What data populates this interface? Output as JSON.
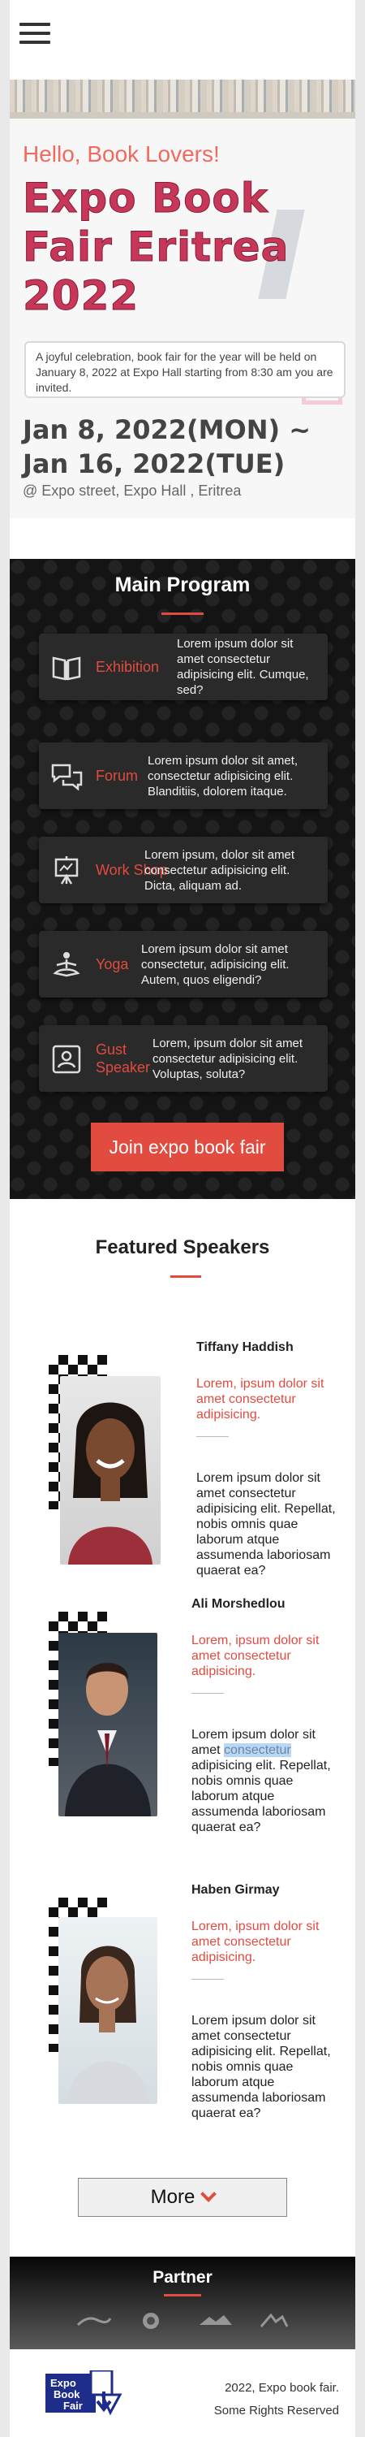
{
  "header": {
    "menu_icon": "hamburger-menu-icon"
  },
  "hero": {
    "greeting": "Hello, Book Lovers!",
    "title": "Expo Book Fair Eritrea 2022",
    "description": "A joyful celebration, book fair for the year will be held on January 8, 2022 at Expo Hall starting from 8:30 am you are invited.",
    "dates": "Jan 8, 2022(MON) ~ Jan 16, 2022(TUE)",
    "address": "@ Expo street, Expo Hall , Eritrea"
  },
  "program": {
    "title": "Main Program",
    "items": [
      {
        "icon": "open-book-icon",
        "name": "Exhibition",
        "text": "Lorem ipsum dolor sit amet consectetur adipisicing elit. Cumque, sed?"
      },
      {
        "icon": "chat-bubbles-icon",
        "name": "Forum",
        "text": "Lorem ipsum dolor sit amet, consectetur adipisicing elit. Blanditiis, dolorem itaque."
      },
      {
        "icon": "easel-board-icon",
        "name": "Work Shop",
        "text": "Lorem ipsum, dolor sit amet consectetur adipisicing elit. Dicta, aliquam ad."
      },
      {
        "icon": "meditation-icon",
        "name": "Yoga",
        "text": "Lorem ipsum dolor sit amet consectetur, adipisicing elit. Autem, quos eligendi?"
      },
      {
        "icon": "id-card-icon",
        "name": "Gust Speaker",
        "text": "Lorem, ipsum dolor sit amet consectetur adipisicing elit. Voluptas, soluta?"
      }
    ],
    "join_label": "Join expo book fair"
  },
  "speakers": {
    "title": "Featured Speakers",
    "items": [
      {
        "name": "Tiffany Haddish",
        "role": "Lorem, ipsum dolor sit amet consectetur adipisicing.",
        "bio": "Lorem ipsum dolor sit amet consectetur adipisicing elit. Repellat, nobis omnis quae laborum atque assumenda laboriosam quaerat ea?"
      },
      {
        "name": "Ali Morshedlou",
        "role": "Lorem, ipsum dolor sit amet consectetur adipisicing.",
        "bio_before": "Lorem ipsum dolor sit amet ",
        "bio_selected": "consectetur",
        "bio_after": " adipisicing elit. Repellat, nobis omnis quae laborum atque assumenda laboriosam quaerat ea?"
      },
      {
        "name": "Haben Girmay",
        "role": "Lorem, ipsum dolor sit amet consectetur adipisicing.",
        "bio": "Lorem ipsum dolor sit amet consectetur adipisicing elit. Repellat, nobis omnis quae laborum atque assumenda laboriosam quaerat ea?"
      }
    ],
    "more_label": "More"
  },
  "partner": {
    "title": "Partner",
    "logos": [
      "partner-logo-1",
      "partner-logo-2",
      "partner-logo-3",
      "partner-logo-4"
    ]
  },
  "footer": {
    "logo_text": [
      "Expo",
      "Book",
      "Fair"
    ],
    "copyright": "2022, Expo book fair.",
    "rights": "Some Rights Reserved"
  },
  "colors": {
    "accent": "#e24b3f",
    "title": "#c8365a",
    "dark_bg": "#141414"
  }
}
